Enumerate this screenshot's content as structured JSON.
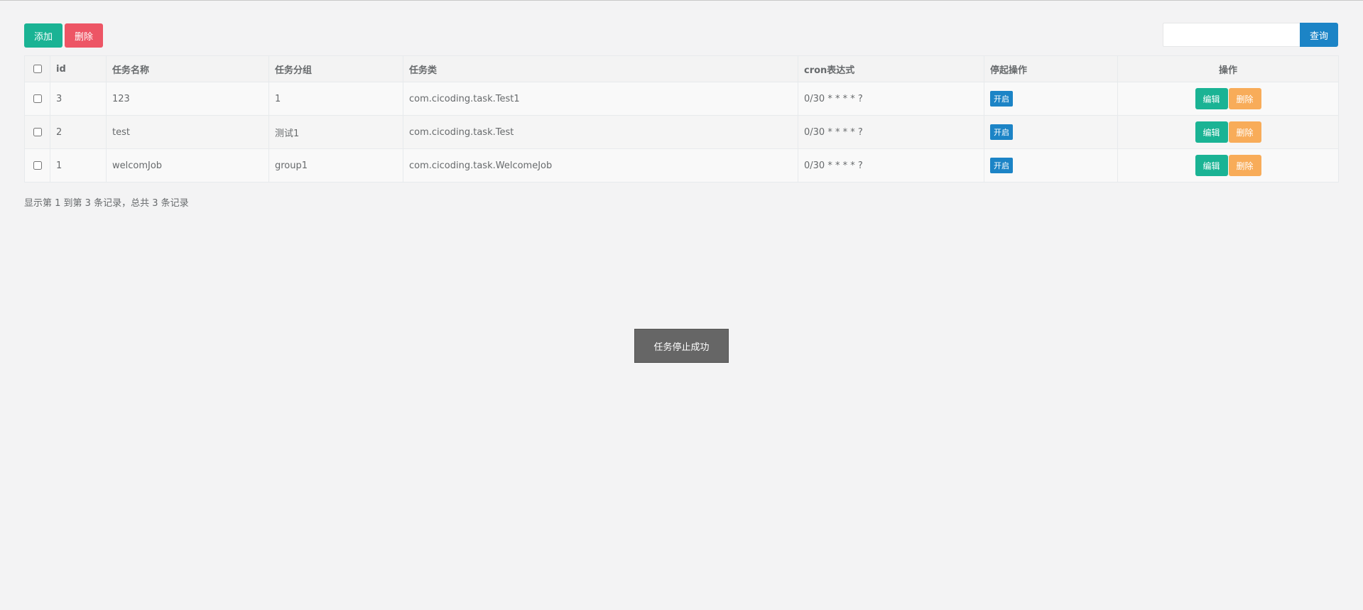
{
  "toolbar": {
    "add_label": "添加",
    "delete_label": "删除"
  },
  "search": {
    "placeholder": "",
    "value": "",
    "query_label": "查询"
  },
  "table": {
    "headers": {
      "id": "id",
      "name": "任务名称",
      "group": "任务分组",
      "class": "任务类",
      "cron": "cron表达式",
      "toggle": "停起操作",
      "ops": "操作"
    },
    "rows": [
      {
        "id": "3",
        "name": "123",
        "group": "1",
        "class": "com.cicoding.task.Test1",
        "cron": "0/30 * * * * ?",
        "toggle": "开启",
        "edit": "编辑",
        "remove": "删除"
      },
      {
        "id": "2",
        "name": "test",
        "group": "测试1",
        "class": "com.cicoding.task.Test",
        "cron": "0/30 * * * * ?",
        "toggle": "开启",
        "edit": "编辑",
        "remove": "删除"
      },
      {
        "id": "1",
        "name": "welcomJob",
        "group": "group1",
        "class": "com.cicoding.task.WelcomeJob",
        "cron": "0/30 * * * * ?",
        "toggle": "开启",
        "edit": "编辑",
        "remove": "删除"
      }
    ]
  },
  "pagination": {
    "info": "显示第 1 到第 3 条记录，总共 3 条记录"
  },
  "toast": {
    "message": "任务停止成功"
  },
  "colors": {
    "primary": "#1ab394",
    "danger": "#ed5565",
    "info": "#1c84c6",
    "warning": "#f8ac59"
  }
}
